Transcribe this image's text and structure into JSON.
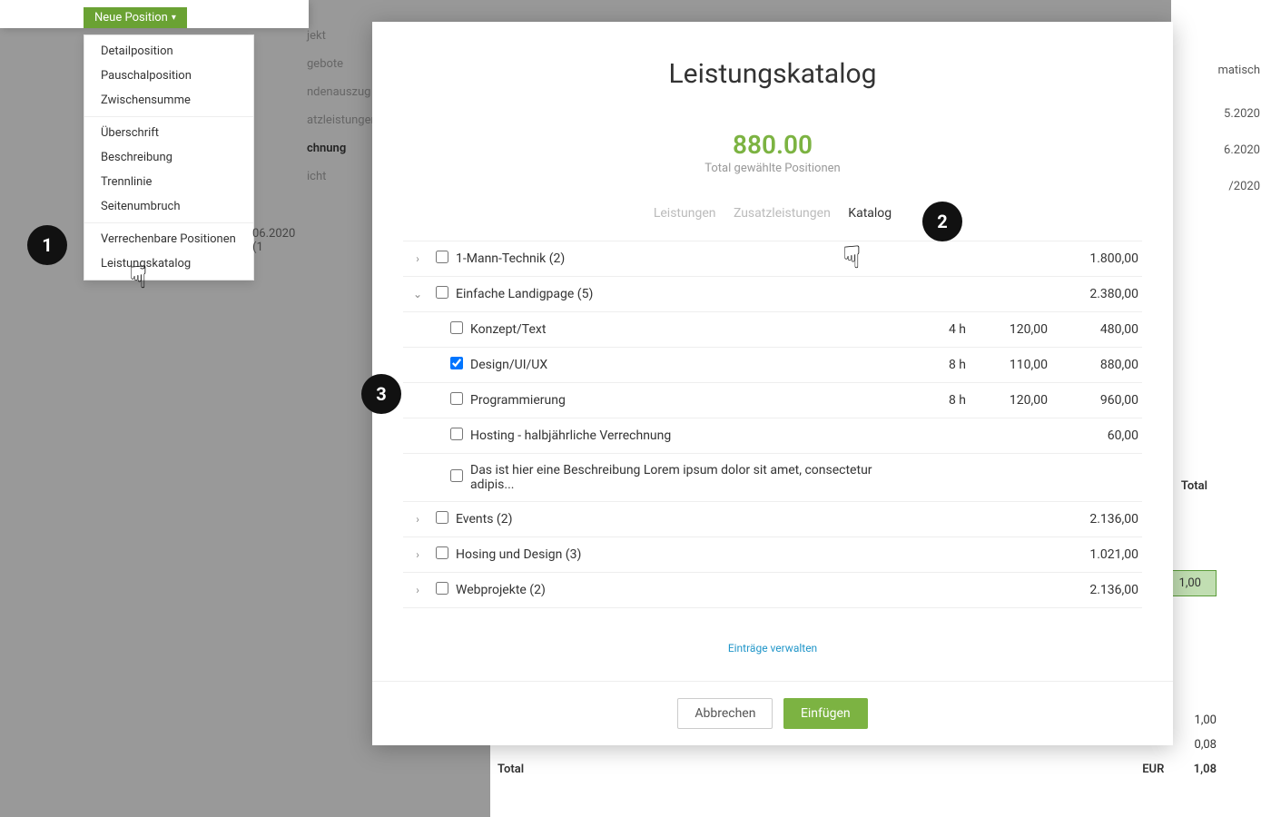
{
  "dropdown": {
    "button_label": "Neue Position",
    "groups": [
      [
        "Detailposition",
        "Pauschalposition",
        "Zwischensumme"
      ],
      [
        "Überschrift",
        "Beschreibung",
        "Trennlinie",
        "Seitenumbruch"
      ],
      [
        "Verrechenbare Positionen",
        "Leistungskatalog"
      ]
    ]
  },
  "bg_tabs": [
    "jekt",
    "gebote",
    "ndenauszug",
    "atzleistungen",
    "chnung",
    "icht"
  ],
  "bg_tab_active_index": 4,
  "bg_date_frag": "06.2020 (1",
  "bg_right": {
    "r1": "matisch",
    "r2": "5.2020",
    "r3": "6.2020",
    "r4": "/2020",
    "total_label": "Total",
    "green": "1,00"
  },
  "bg_bottom": {
    "rows": [
      {
        "label": "",
        "val": "1,00"
      },
      {
        "label": "",
        "val": "0,08"
      }
    ],
    "total_label": "Total",
    "total_currency": "EUR",
    "total_val": "1,08"
  },
  "steps": {
    "s1": "1",
    "s2": "2",
    "s3": "3"
  },
  "modal": {
    "title": "Leistungskatalog",
    "total_amount": "880.00",
    "total_sub": "Total gewählte Positionen",
    "tabs": [
      "Leistungen",
      "Zusatzleistungen",
      "Katalog"
    ],
    "active_tab": 2,
    "manage_link": "Einträge verwalten",
    "footer": {
      "cancel": "Abbrechen",
      "insert": "Einfügen"
    },
    "rows": [
      {
        "type": "group",
        "expanded": false,
        "label": "1-Mann-Technik (2)",
        "total": "1.800,00"
      },
      {
        "type": "group",
        "expanded": true,
        "label": "Einfache Landigpage (5)",
        "total": "2.380,00"
      },
      {
        "type": "child",
        "checked": false,
        "label": "Konzept/Text",
        "qty": "4 h",
        "rate": "120,00",
        "total": "480,00"
      },
      {
        "type": "child",
        "checked": true,
        "label": "Design/UI/UX",
        "qty": "8 h",
        "rate": "110,00",
        "total": "880,00"
      },
      {
        "type": "child",
        "checked": false,
        "label": "Programmierung",
        "qty": "8 h",
        "rate": "120,00",
        "total": "960,00"
      },
      {
        "type": "child",
        "checked": false,
        "label": "Hosting - halbjährliche Verrechnung",
        "qty": "",
        "rate": "",
        "total": "60,00"
      },
      {
        "type": "child",
        "checked": false,
        "label": "Das ist hier eine Beschreibung Lorem ipsum dolor sit amet, consectetur adipis...",
        "qty": "",
        "rate": "",
        "total": ""
      },
      {
        "type": "group",
        "expanded": false,
        "label": "Events (2)",
        "total": "2.136,00"
      },
      {
        "type": "group",
        "expanded": false,
        "label": "Hosing und Design (3)",
        "total": "1.021,00"
      },
      {
        "type": "group",
        "expanded": false,
        "label": "Webprojekte (2)",
        "total": "2.136,00"
      }
    ]
  }
}
